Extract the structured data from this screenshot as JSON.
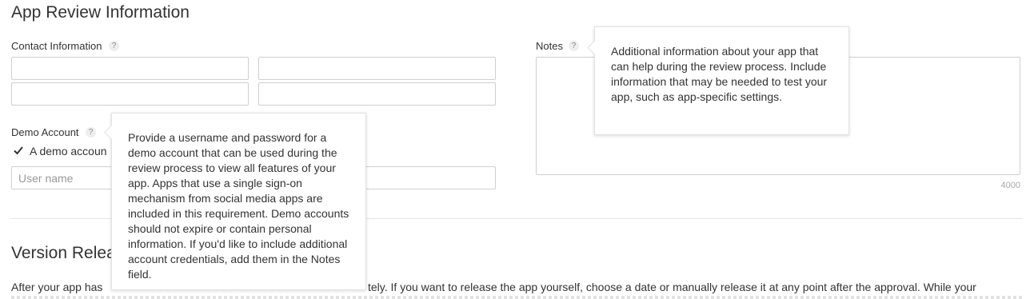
{
  "section_title": "App Review Information",
  "contact": {
    "label": "Contact Information",
    "help": "?"
  },
  "demo": {
    "label": "Demo Account",
    "help": "?",
    "checkbox_label": "A demo accoun",
    "username_placeholder": "User name",
    "tooltip": "Provide a username and password for a demo account that can be used during the review process to view all features of your app. Apps that use a single sign-on mechanism from social media apps are included in this requirement. Demo accounts should not expire or contain personal information. If you'd like to include additional account credentials, add them in the Notes field."
  },
  "notes": {
    "label": "Notes",
    "help": "?",
    "char_count": "4000",
    "tooltip": "Additional information about your app that can help during the review process. Include information that may be needed to test your app, such as app-specific settings."
  },
  "version_release": {
    "title": "Version Relea",
    "text_left": "After your app has",
    "text_right": "tely. If you want to release the app yourself, choose a date or manually release it at any point after the approval. While your"
  }
}
